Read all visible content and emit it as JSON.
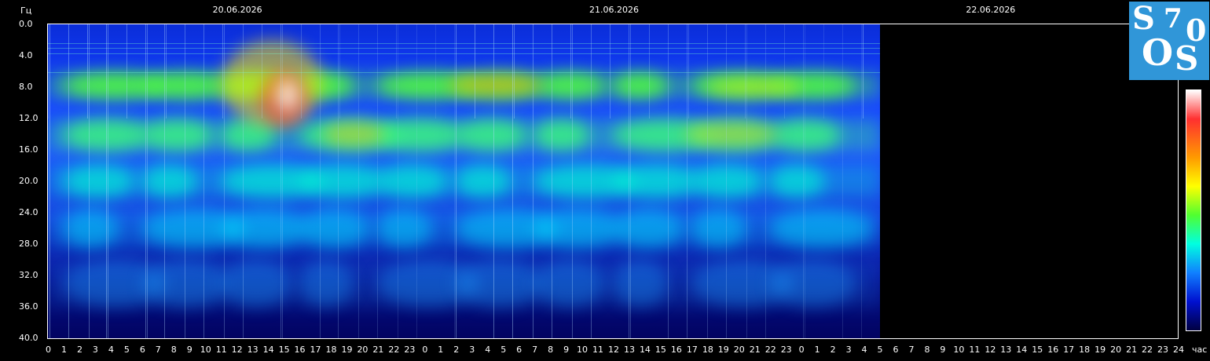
{
  "chart_data": {
    "type": "heatmap",
    "title": "",
    "xlabel": "час",
    "ylabel": "Гц",
    "dates": [
      "20.06.2026",
      "21.06.2026",
      "22.06.2026"
    ],
    "x_tick_labels": [
      "0",
      "1",
      "2",
      "3",
      "4",
      "5",
      "6",
      "7",
      "8",
      "9",
      "10",
      "11",
      "12",
      "13",
      "14",
      "15",
      "16",
      "17",
      "18",
      "19",
      "20",
      "21",
      "22",
      "23",
      "0",
      "1",
      "2",
      "3",
      "4",
      "5",
      "6",
      "7",
      "8",
      "9",
      "10",
      "11",
      "12",
      "13",
      "14",
      "15",
      "16",
      "17",
      "18",
      "19",
      "20",
      "21",
      "22",
      "23",
      "0",
      "1",
      "2",
      "3",
      "4",
      "5",
      "6",
      "7",
      "8",
      "9",
      "10",
      "11",
      "12",
      "13",
      "14",
      "15",
      "16",
      "17",
      "18",
      "19",
      "20",
      "21",
      "22",
      "23",
      "24"
    ],
    "y_tick_labels": [
      "0.0",
      "4.0",
      "8.0",
      "12.0",
      "16.0",
      "20.0",
      "24.0",
      "28.0",
      "32.0",
      "36.0",
      "40.0"
    ],
    "xlim_hours": [
      0,
      72
    ],
    "ylim": [
      0,
      40
    ],
    "data_end_hour": 53,
    "colormap": [
      "#000040",
      "#0010d0",
      "#1080ff",
      "#00ffe0",
      "#50ff30",
      "#ffff00",
      "#ff9a00",
      "#ff3030",
      "#ffffff"
    ],
    "background_color": "#000000",
    "grid": false,
    "legend": "colorbar right",
    "bands_hz": [
      7.8,
      14.1,
      20.0,
      26.0,
      33.0
    ]
  },
  "logo": {
    "letters": [
      "S",
      "7",
      "0",
      "O",
      "S"
    ],
    "color": "#3096d8"
  }
}
